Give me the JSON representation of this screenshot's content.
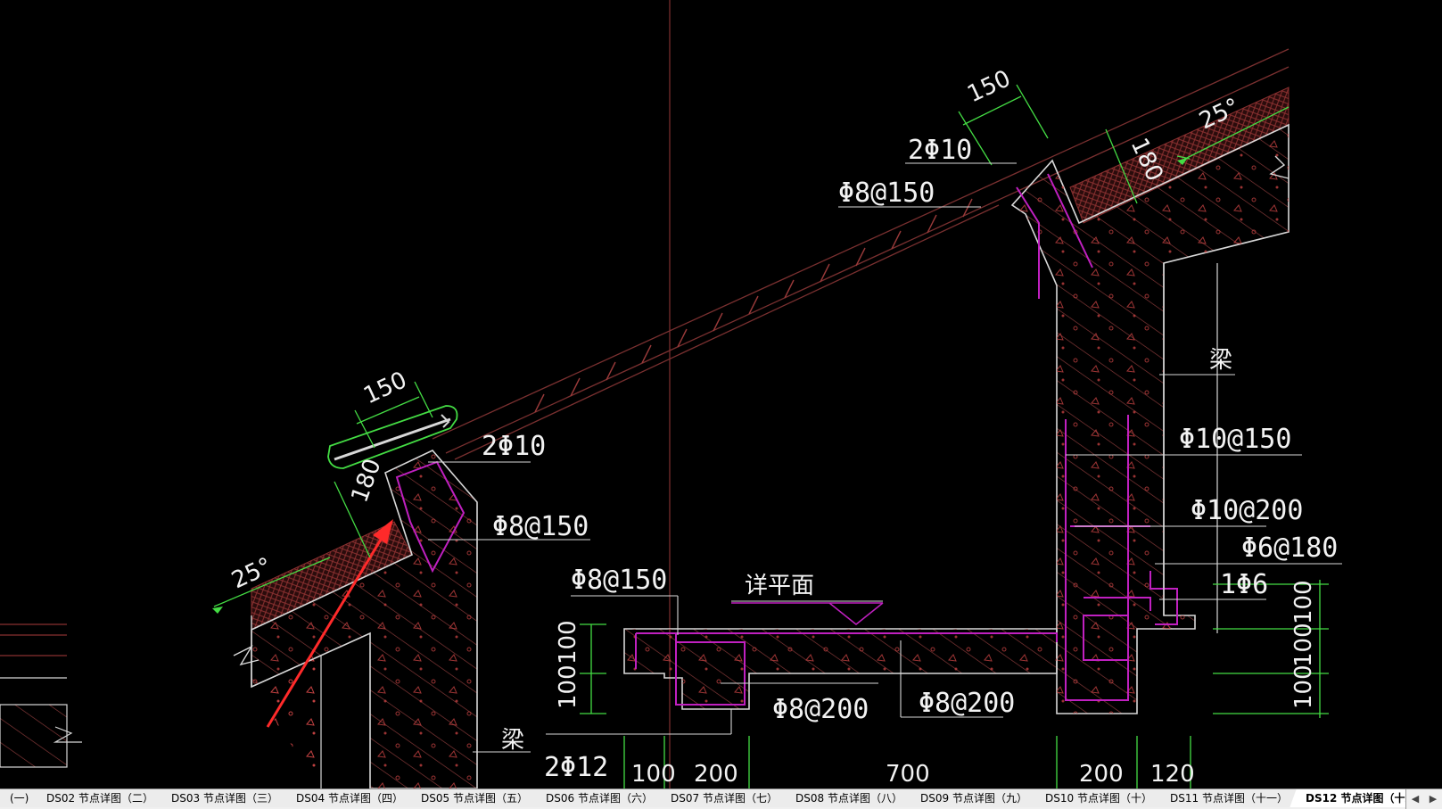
{
  "drawing": {
    "labels": {
      "l_2phi10_top": "2Φ10",
      "l_phi8_150_top": "Φ8@150",
      "l_150_top": "150",
      "l_180_top": "180",
      "l_25_top": "25°",
      "l_liang_right": "梁",
      "l_phi10_150": "Φ10@150",
      "l_phi10_200": "Φ10@200",
      "l_phi6_180": "Φ6@180",
      "l_1phi6": "1Φ6",
      "l_150_left": "150",
      "l_2phi10_left": "2Φ10",
      "l_phi8_150_left": "Φ8@150",
      "l_180_left": "180",
      "l_25_left": "25°",
      "l_phi8_150_mid": "Φ8@150",
      "l_xiangpingmian": "详平面",
      "l_phi8_200_a": "Φ8@200",
      "l_phi8_200_b": "Φ8@200",
      "l_liang_left": "梁",
      "l_2phi12": "2Φ12",
      "l_100_v1": "100",
      "l_100_v2": "100",
      "l_100_r1": "100",
      "l_100_r2": "100",
      "l_100_r3": "100",
      "l_100_b": "100",
      "l_200_b1": "200",
      "l_700_b": "700",
      "l_200_b2": "200",
      "l_120_b": "120"
    },
    "colors": {
      "concrete": "#d8d8d8",
      "hatch": "#8a3a3a",
      "rebar": "#c020c0",
      "dimension": "#44dd44",
      "arrow": "#ff2a2a",
      "insulation": "#7a3030",
      "roof_lines": "#7a3030"
    }
  },
  "tabs": [
    {
      "label": "(一)"
    },
    {
      "label": "DS02 节点详图（二）"
    },
    {
      "label": "DS03 节点详图（三）"
    },
    {
      "label": "DS04 节点详图（四）"
    },
    {
      "label": "DS05 节点详图（五）"
    },
    {
      "label": "DS06 节点详图（六）"
    },
    {
      "label": "DS07 节点详图（七）"
    },
    {
      "label": "DS08 节点详图（八）"
    },
    {
      "label": "DS09 节点详图（九）"
    },
    {
      "label": "DS10 节点详图（十）"
    },
    {
      "label": "DS11 节点详图（十一）"
    },
    {
      "label": "DS12 节点详图（十二）",
      "active": true
    }
  ],
  "tab_scroll": {
    "left": "◀",
    "right": "▶"
  }
}
